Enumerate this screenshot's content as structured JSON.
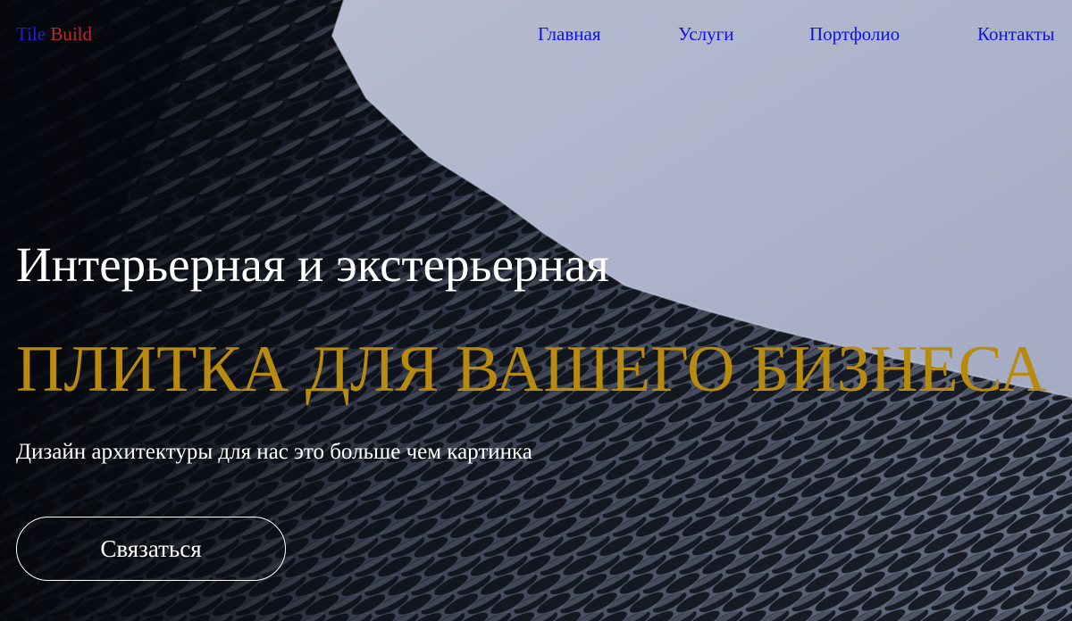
{
  "header": {
    "logo": {
      "part1": "Tile",
      "part2": "Build"
    },
    "nav": [
      {
        "label": "Главная"
      },
      {
        "label": "Услуги"
      },
      {
        "label": "Портфолио"
      },
      {
        "label": "Контакты"
      }
    ]
  },
  "hero": {
    "title": "Интерьерная и экстерьерная",
    "accent": "ПЛИТКА ДЛЯ ВАШЕГО БИЗНЕСА",
    "subtitle": "Дизайн архитектуры для нас это больше чем картинка",
    "button_label": "Связаться",
    "background_image": "architectural-facade-lattice-photo"
  },
  "colors": {
    "logo_tile": "#1f1fd2",
    "logo_build": "#c0272b",
    "nav_link": "#1111e8",
    "accent_text": "#b88a0e",
    "text_light": "#ffffff",
    "sky": "#a9b0c6"
  }
}
